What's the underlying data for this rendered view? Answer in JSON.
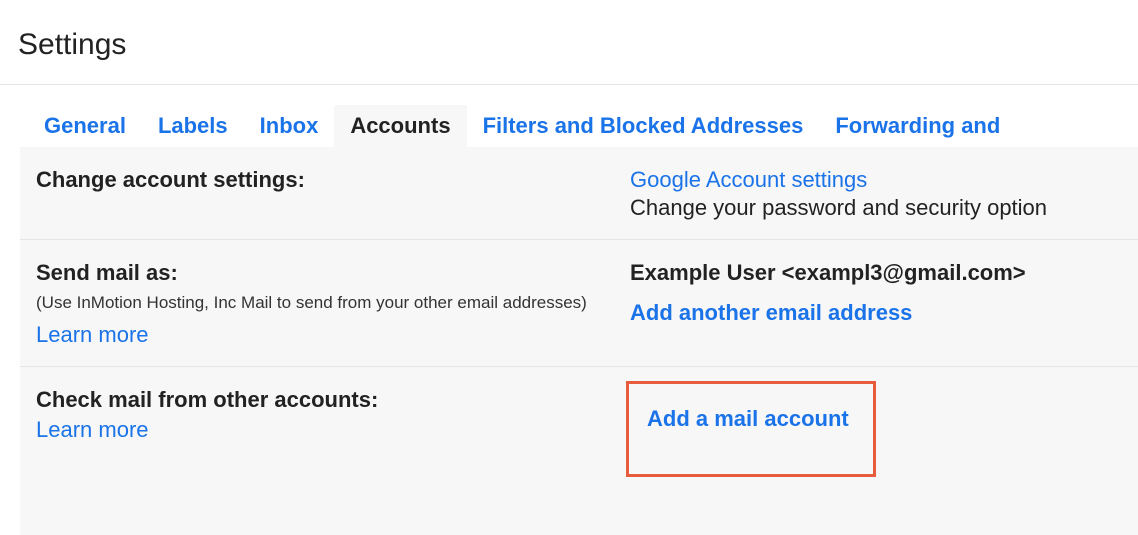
{
  "page": {
    "title": "Settings"
  },
  "tabs": {
    "general": "General",
    "labels": "Labels",
    "inbox": "Inbox",
    "accounts": "Accounts",
    "filters": "Filters and Blocked Addresses",
    "forwarding": "Forwarding and "
  },
  "sections": {
    "change_account": {
      "label": "Change account settings:",
      "link": "Google Account settings",
      "desc": "Change your password and security option"
    },
    "send_mail_as": {
      "label": "Send mail as:",
      "hint": "(Use InMotion Hosting, Inc Mail to send from your other email addresses)",
      "learn_more": "Learn more",
      "identity": "Example User <exampl3@gmail.com>",
      "add_link": "Add another email address"
    },
    "check_mail": {
      "label": "Check mail from other accounts:",
      "learn_more": "Learn more",
      "add_link": "Add a mail account"
    }
  }
}
